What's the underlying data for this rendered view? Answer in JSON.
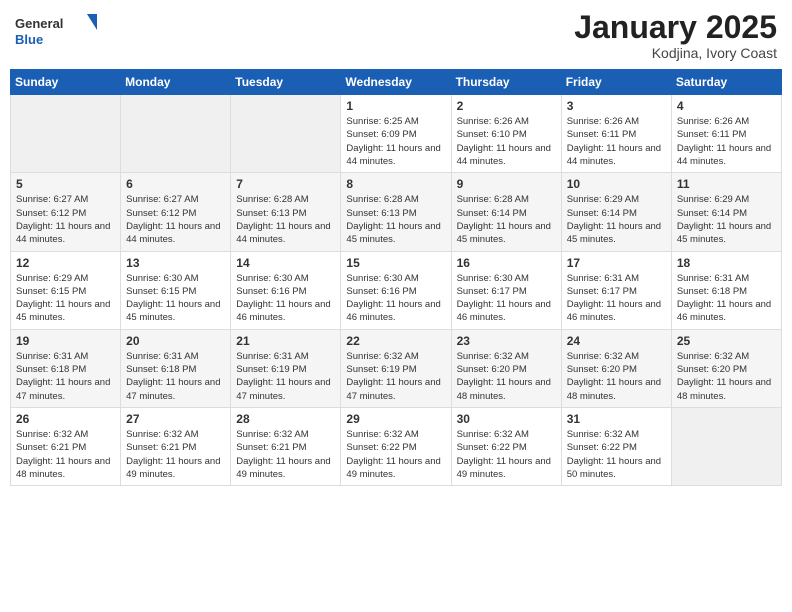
{
  "header": {
    "logo_general": "General",
    "logo_blue": "Blue",
    "month_year": "January 2025",
    "location": "Kodjina, Ivory Coast"
  },
  "weekdays": [
    "Sunday",
    "Monday",
    "Tuesday",
    "Wednesday",
    "Thursday",
    "Friday",
    "Saturday"
  ],
  "weeks": [
    [
      {
        "day": "",
        "sunrise": "",
        "sunset": "",
        "daylight": "",
        "empty": true
      },
      {
        "day": "",
        "sunrise": "",
        "sunset": "",
        "daylight": "",
        "empty": true
      },
      {
        "day": "",
        "sunrise": "",
        "sunset": "",
        "daylight": "",
        "empty": true
      },
      {
        "day": "1",
        "sunrise": "Sunrise: 6:25 AM",
        "sunset": "Sunset: 6:09 PM",
        "daylight": "Daylight: 11 hours and 44 minutes."
      },
      {
        "day": "2",
        "sunrise": "Sunrise: 6:26 AM",
        "sunset": "Sunset: 6:10 PM",
        "daylight": "Daylight: 11 hours and 44 minutes."
      },
      {
        "day": "3",
        "sunrise": "Sunrise: 6:26 AM",
        "sunset": "Sunset: 6:11 PM",
        "daylight": "Daylight: 11 hours and 44 minutes."
      },
      {
        "day": "4",
        "sunrise": "Sunrise: 6:26 AM",
        "sunset": "Sunset: 6:11 PM",
        "daylight": "Daylight: 11 hours and 44 minutes."
      }
    ],
    [
      {
        "day": "5",
        "sunrise": "Sunrise: 6:27 AM",
        "sunset": "Sunset: 6:12 PM",
        "daylight": "Daylight: 11 hours and 44 minutes."
      },
      {
        "day": "6",
        "sunrise": "Sunrise: 6:27 AM",
        "sunset": "Sunset: 6:12 PM",
        "daylight": "Daylight: 11 hours and 44 minutes."
      },
      {
        "day": "7",
        "sunrise": "Sunrise: 6:28 AM",
        "sunset": "Sunset: 6:13 PM",
        "daylight": "Daylight: 11 hours and 44 minutes."
      },
      {
        "day": "8",
        "sunrise": "Sunrise: 6:28 AM",
        "sunset": "Sunset: 6:13 PM",
        "daylight": "Daylight: 11 hours and 45 minutes."
      },
      {
        "day": "9",
        "sunrise": "Sunrise: 6:28 AM",
        "sunset": "Sunset: 6:14 PM",
        "daylight": "Daylight: 11 hours and 45 minutes."
      },
      {
        "day": "10",
        "sunrise": "Sunrise: 6:29 AM",
        "sunset": "Sunset: 6:14 PM",
        "daylight": "Daylight: 11 hours and 45 minutes."
      },
      {
        "day": "11",
        "sunrise": "Sunrise: 6:29 AM",
        "sunset": "Sunset: 6:14 PM",
        "daylight": "Daylight: 11 hours and 45 minutes."
      }
    ],
    [
      {
        "day": "12",
        "sunrise": "Sunrise: 6:29 AM",
        "sunset": "Sunset: 6:15 PM",
        "daylight": "Daylight: 11 hours and 45 minutes."
      },
      {
        "day": "13",
        "sunrise": "Sunrise: 6:30 AM",
        "sunset": "Sunset: 6:15 PM",
        "daylight": "Daylight: 11 hours and 45 minutes."
      },
      {
        "day": "14",
        "sunrise": "Sunrise: 6:30 AM",
        "sunset": "Sunset: 6:16 PM",
        "daylight": "Daylight: 11 hours and 46 minutes."
      },
      {
        "day": "15",
        "sunrise": "Sunrise: 6:30 AM",
        "sunset": "Sunset: 6:16 PM",
        "daylight": "Daylight: 11 hours and 46 minutes."
      },
      {
        "day": "16",
        "sunrise": "Sunrise: 6:30 AM",
        "sunset": "Sunset: 6:17 PM",
        "daylight": "Daylight: 11 hours and 46 minutes."
      },
      {
        "day": "17",
        "sunrise": "Sunrise: 6:31 AM",
        "sunset": "Sunset: 6:17 PM",
        "daylight": "Daylight: 11 hours and 46 minutes."
      },
      {
        "day": "18",
        "sunrise": "Sunrise: 6:31 AM",
        "sunset": "Sunset: 6:18 PM",
        "daylight": "Daylight: 11 hours and 46 minutes."
      }
    ],
    [
      {
        "day": "19",
        "sunrise": "Sunrise: 6:31 AM",
        "sunset": "Sunset: 6:18 PM",
        "daylight": "Daylight: 11 hours and 47 minutes."
      },
      {
        "day": "20",
        "sunrise": "Sunrise: 6:31 AM",
        "sunset": "Sunset: 6:18 PM",
        "daylight": "Daylight: 11 hours and 47 minutes."
      },
      {
        "day": "21",
        "sunrise": "Sunrise: 6:31 AM",
        "sunset": "Sunset: 6:19 PM",
        "daylight": "Daylight: 11 hours and 47 minutes."
      },
      {
        "day": "22",
        "sunrise": "Sunrise: 6:32 AM",
        "sunset": "Sunset: 6:19 PM",
        "daylight": "Daylight: 11 hours and 47 minutes."
      },
      {
        "day": "23",
        "sunrise": "Sunrise: 6:32 AM",
        "sunset": "Sunset: 6:20 PM",
        "daylight": "Daylight: 11 hours and 48 minutes."
      },
      {
        "day": "24",
        "sunrise": "Sunrise: 6:32 AM",
        "sunset": "Sunset: 6:20 PM",
        "daylight": "Daylight: 11 hours and 48 minutes."
      },
      {
        "day": "25",
        "sunrise": "Sunrise: 6:32 AM",
        "sunset": "Sunset: 6:20 PM",
        "daylight": "Daylight: 11 hours and 48 minutes."
      }
    ],
    [
      {
        "day": "26",
        "sunrise": "Sunrise: 6:32 AM",
        "sunset": "Sunset: 6:21 PM",
        "daylight": "Daylight: 11 hours and 48 minutes."
      },
      {
        "day": "27",
        "sunrise": "Sunrise: 6:32 AM",
        "sunset": "Sunset: 6:21 PM",
        "daylight": "Daylight: 11 hours and 49 minutes."
      },
      {
        "day": "28",
        "sunrise": "Sunrise: 6:32 AM",
        "sunset": "Sunset: 6:21 PM",
        "daylight": "Daylight: 11 hours and 49 minutes."
      },
      {
        "day": "29",
        "sunrise": "Sunrise: 6:32 AM",
        "sunset": "Sunset: 6:22 PM",
        "daylight": "Daylight: 11 hours and 49 minutes."
      },
      {
        "day": "30",
        "sunrise": "Sunrise: 6:32 AM",
        "sunset": "Sunset: 6:22 PM",
        "daylight": "Daylight: 11 hours and 49 minutes."
      },
      {
        "day": "31",
        "sunrise": "Sunrise: 6:32 AM",
        "sunset": "Sunset: 6:22 PM",
        "daylight": "Daylight: 11 hours and 50 minutes."
      },
      {
        "day": "",
        "sunrise": "",
        "sunset": "",
        "daylight": "",
        "empty": true
      }
    ]
  ]
}
